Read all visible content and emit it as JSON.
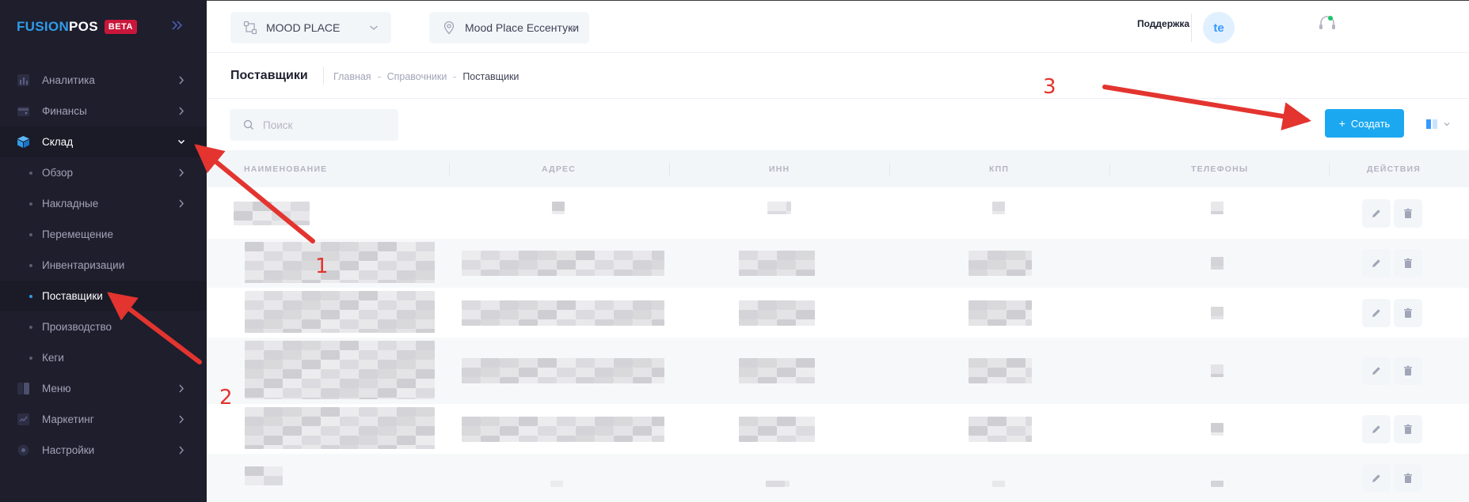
{
  "brand": {
    "logo_part1": "FUSION",
    "logo_part2": "POS",
    "badge": "BETA",
    "accent_color": "#2f9ce8",
    "badge_color": "#c8173b"
  },
  "sidebar": {
    "items": [
      {
        "label": "Аналитика",
        "icon": "analytics-icon"
      },
      {
        "label": "Финансы",
        "icon": "wallet-icon"
      },
      {
        "label": "Склад",
        "icon": "box-icon"
      },
      {
        "label": "Обзор"
      },
      {
        "label": "Накладные"
      },
      {
        "label": "Перемещение"
      },
      {
        "label": "Инвентаризации"
      },
      {
        "label": "Поставщики"
      },
      {
        "label": "Производство"
      },
      {
        "label": "Кеги"
      },
      {
        "label": "Меню",
        "icon": "menu-book-icon"
      },
      {
        "label": "Маркетинг",
        "icon": "marketing-icon"
      },
      {
        "label": "Настройки",
        "icon": "settings-icon"
      }
    ]
  },
  "header": {
    "organization": "MOOD PLACE",
    "location": "Mood Place Ессентуки",
    "support_label": "Поддержка",
    "avatar_initials": "te"
  },
  "page": {
    "title": "Поставщики",
    "breadcrumbs": [
      "Главная",
      "Справочники",
      "Поставщики"
    ]
  },
  "toolbar": {
    "search_placeholder": "Поиск",
    "create_label": "Создать",
    "create_color": "#1ba8f0"
  },
  "table": {
    "columns": [
      "Наименование",
      "Адрес",
      "ИНН",
      "КПП",
      "Телефоны",
      "Действия"
    ],
    "row_count": 6,
    "row_values_note": "pixelated"
  },
  "annotations": {
    "numbers": [
      "1",
      "2",
      "3"
    ],
    "color": "#e3342f"
  }
}
